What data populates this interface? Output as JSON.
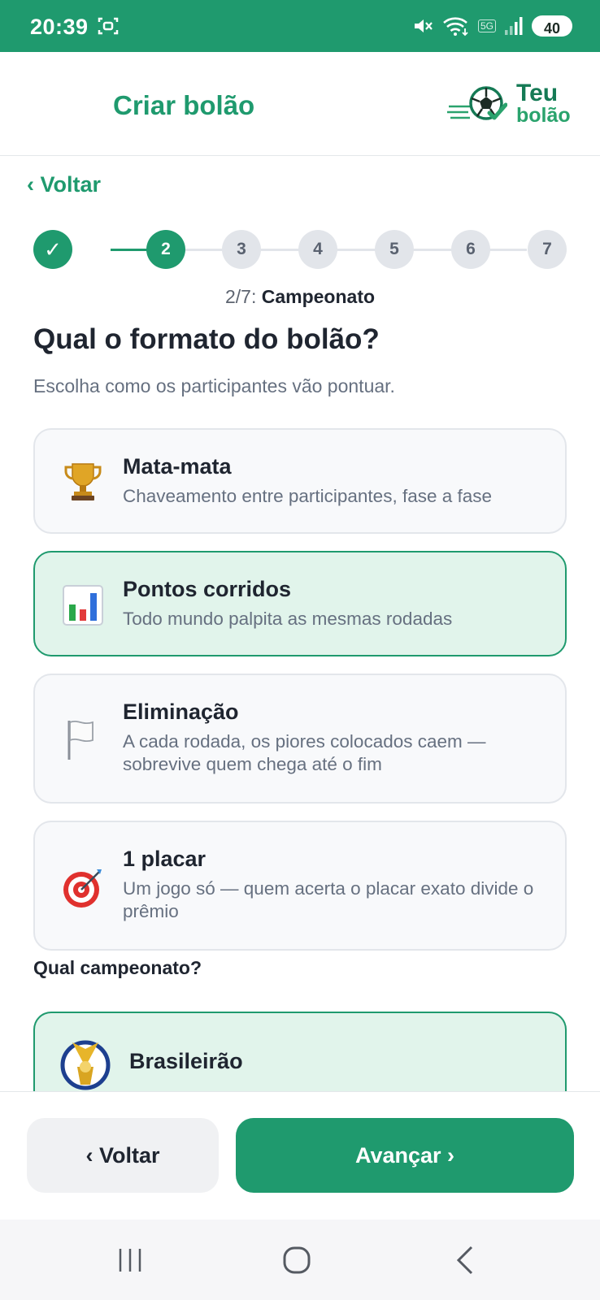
{
  "status_bar": {
    "time": "20:39",
    "network": "5G",
    "battery": "40"
  },
  "header": {
    "title": "Criar bolão",
    "logo_line1": "Teu",
    "logo_line2": "bolão"
  },
  "back_link": "‹ Voltar",
  "stepper": {
    "steps": [
      {
        "label": "✓",
        "state": "done"
      },
      {
        "label": "2",
        "state": "active"
      },
      {
        "label": "3",
        "state": "pending"
      },
      {
        "label": "4",
        "state": "pending"
      },
      {
        "label": "5",
        "state": "pending"
      },
      {
        "label": "6",
        "state": "pending"
      },
      {
        "label": "7",
        "state": "pending"
      }
    ],
    "caption_prefix": "2/7:",
    "caption_name": "Campeonato"
  },
  "question": "Qual o formato do bolão?",
  "subtitle": "Escolha como os participantes vão pontuar.",
  "formats": [
    {
      "icon": "trophy-icon",
      "title": "Mata-mata",
      "desc": "Chaveamento entre participantes, fase a fase",
      "selected": false
    },
    {
      "icon": "bar-chart-icon",
      "title": "Pontos corridos",
      "desc": "Todo mundo palpita as mesmas rodadas",
      "selected": true
    },
    {
      "icon": "white-flag-icon",
      "title": "Eliminação",
      "desc": "A cada rodada, os piores colocados caem — sobrevive quem chega até o fim",
      "selected": false
    },
    {
      "icon": "target-icon",
      "title": "1 placar",
      "desc": "Um jogo só — quem acerta o placar exato divide o prêmio",
      "selected": false
    }
  ],
  "championship": {
    "label": "Qual campeonato?",
    "selected_name": "Brasileirão",
    "icon": "brasileirao-badge-icon"
  },
  "footer": {
    "back_label": "‹ Voltar",
    "next_label": "Avançar ›"
  },
  "colors": {
    "primary": "#1f9a6e",
    "selected_bg": "#e1f4eb",
    "card_bg": "#f8f9fb"
  }
}
